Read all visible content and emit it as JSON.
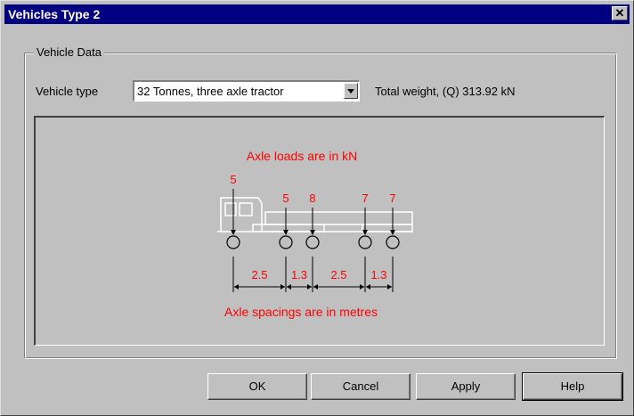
{
  "window": {
    "title": "Vehicles Type 2",
    "close_glyph": "✕"
  },
  "group": {
    "legend": "Vehicle Data"
  },
  "vehicle_type": {
    "label": "Vehicle type",
    "selected": "32 Tonnes, three axle tractor"
  },
  "total_weight": "Total weight, (Q) 313.92 kN",
  "diagram": {
    "loads_caption": "Axle loads are in kN",
    "spacings_caption": "Axle spacings are in metres",
    "axle_loads": [
      "5",
      "5",
      "8",
      "7",
      "7"
    ],
    "spacings": [
      "2.5",
      "1.3",
      "2.5",
      "1.3"
    ],
    "caption_color": "#ff0000"
  },
  "buttons": {
    "ok": "OK",
    "cancel": "Cancel",
    "apply": "Apply",
    "help": "Help"
  }
}
